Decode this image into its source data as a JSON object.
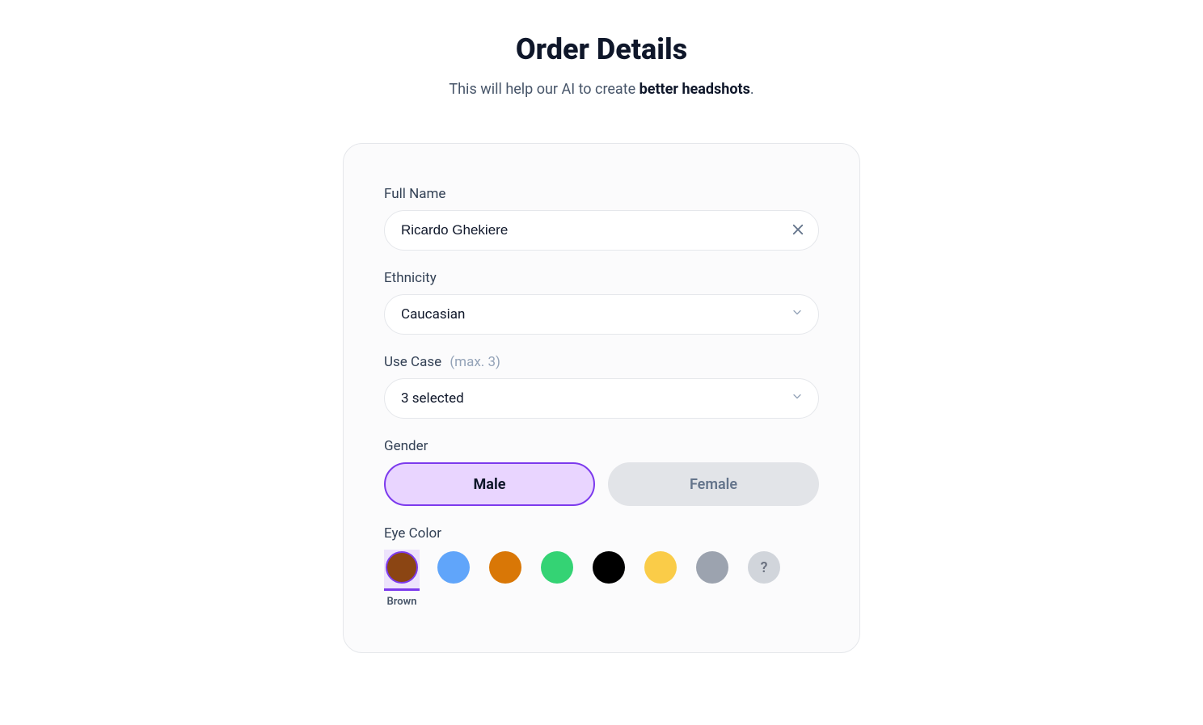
{
  "header": {
    "title": "Order Details",
    "subtitle_prefix": "This will help our AI to create ",
    "subtitle_bold": "better headshots",
    "subtitle_suffix": "."
  },
  "form": {
    "full_name": {
      "label": "Full Name",
      "value": "Ricardo Ghekiere"
    },
    "ethnicity": {
      "label": "Ethnicity",
      "value": "Caucasian"
    },
    "use_case": {
      "label": "Use Case",
      "hint": "(max. 3)",
      "value": "3 selected"
    },
    "gender": {
      "label": "Gender",
      "options": [
        {
          "label": "Male",
          "selected": true
        },
        {
          "label": "Female",
          "selected": false
        }
      ]
    },
    "eye_color": {
      "label": "Eye Color",
      "options": [
        {
          "name": "Brown",
          "hex": "#8b4513",
          "selected": true
        },
        {
          "name": "Blue",
          "hex": "#60a5fa",
          "selected": false
        },
        {
          "name": "Amber",
          "hex": "#d97706",
          "selected": false
        },
        {
          "name": "Green",
          "hex": "#34d374",
          "selected": false
        },
        {
          "name": "Black",
          "hex": "#000000",
          "selected": false
        },
        {
          "name": "Hazel",
          "hex": "#facc48",
          "selected": false
        },
        {
          "name": "Gray",
          "hex": "#9ca3af",
          "selected": false
        }
      ],
      "other_label": "?"
    }
  }
}
